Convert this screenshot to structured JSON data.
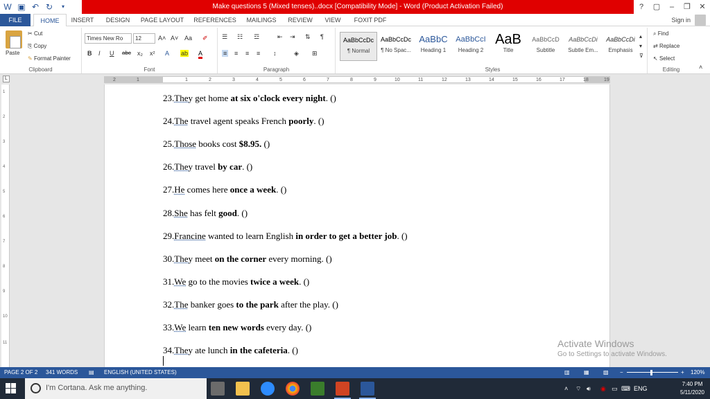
{
  "window": {
    "title": "Make questions 5 (Mixed tenses)..docx [Compatibility Mode] - Word (Product Activation Failed)",
    "controls": [
      "?",
      "▢",
      "–",
      "❐",
      "✕"
    ]
  },
  "tabs": [
    "FILE",
    "HOME",
    "INSERT",
    "DESIGN",
    "PAGE LAYOUT",
    "REFERENCES",
    "MAILINGS",
    "REVIEW",
    "VIEW",
    "FOXIT PDF"
  ],
  "active_tab": "HOME",
  "sign_in": "Sign in",
  "ribbon": {
    "clipboard": {
      "paste": "Paste",
      "cut": "Cut",
      "copy": "Copy",
      "format_painter": "Format Painter",
      "label": "Clipboard"
    },
    "font": {
      "family": "Times New Ro",
      "size": "12",
      "label": "Font"
    },
    "paragraph": {
      "label": "Paragraph"
    },
    "styles": {
      "label": "Styles",
      "items": [
        {
          "preview": "AaBbCcDc",
          "name": "¶ Normal"
        },
        {
          "preview": "AaBbCcDc",
          "name": "¶ No Spac..."
        },
        {
          "preview": "AaBbC",
          "name": "Heading 1"
        },
        {
          "preview": "AaBbCcI",
          "name": "Heading 2"
        },
        {
          "preview": "AaB",
          "name": "Title"
        },
        {
          "preview": "AaBbCcD",
          "name": "Subtitle"
        },
        {
          "preview": "AaBbCcDi",
          "name": "Subtle Em..."
        },
        {
          "preview": "AaBbCcDi",
          "name": "Emphasis"
        }
      ]
    },
    "editing": {
      "find": "Find",
      "replace": "Replace",
      "select": "Select",
      "label": "Editing"
    }
  },
  "ruler_numbers": [
    "2",
    "1",
    "1",
    "2",
    "3",
    "4",
    "5",
    "6",
    "7",
    "8",
    "9",
    "10",
    "11",
    "12",
    "13",
    "14",
    "15",
    "16",
    "17",
    "18",
    "19"
  ],
  "vruler_numbers": [
    "1",
    "2",
    "3",
    "4",
    "5",
    "6",
    "7",
    "8",
    "9",
    "10",
    "11"
  ],
  "document": {
    "lines": [
      {
        "num": "23.",
        "subject": "They",
        "parts": [
          {
            "t": " get home ",
            "b": false
          },
          {
            "t": "at six o'clock every night",
            "b": true
          },
          {
            "t": ". ()",
            "b": false
          }
        ]
      },
      {
        "num": "24.",
        "subject": "The",
        "parts": [
          {
            "t": " travel agent speaks French ",
            "b": false
          },
          {
            "t": "poorly",
            "b": true
          },
          {
            "t": ". ()",
            "b": false
          }
        ]
      },
      {
        "num": "25.",
        "subject": "Those",
        "parts": [
          {
            "t": " books cost ",
            "b": false
          },
          {
            "t": "$8.95.",
            "b": true
          },
          {
            "t": " ()",
            "b": false
          }
        ]
      },
      {
        "num": "26.",
        "subject": "They",
        "parts": [
          {
            "t": " travel ",
            "b": false
          },
          {
            "t": "by car",
            "b": true
          },
          {
            "t": ". ()",
            "b": false
          }
        ]
      },
      {
        "num": "27.",
        "subject": "He",
        "parts": [
          {
            "t": " comes here ",
            "b": false
          },
          {
            "t": "once a week",
            "b": true
          },
          {
            "t": ". ()",
            "b": false
          }
        ]
      },
      {
        "num": "28.",
        "subject": "She",
        "parts": [
          {
            "t": " has felt ",
            "b": false
          },
          {
            "t": "good",
            "b": true
          },
          {
            "t": ". ()",
            "b": false
          }
        ]
      },
      {
        "num": "29.",
        "subject": "Francine",
        "parts": [
          {
            "t": " wanted to learn English ",
            "b": false
          },
          {
            "t": "in order to get a better job",
            "b": true
          },
          {
            "t": ". ()",
            "b": false
          }
        ]
      },
      {
        "num": "30.",
        "subject": "They",
        "parts": [
          {
            "t": " meet ",
            "b": false
          },
          {
            "t": "on the corner",
            "b": true
          },
          {
            "t": " every morning. ()",
            "b": false
          }
        ]
      },
      {
        "num": "31.",
        "subject": "We",
        "parts": [
          {
            "t": " go to the movies ",
            "b": false
          },
          {
            "t": "twice a week",
            "b": true
          },
          {
            "t": ". ()",
            "b": false
          }
        ]
      },
      {
        "num": "32.",
        "subject": "The",
        "parts": [
          {
            "t": " banker goes ",
            "b": false
          },
          {
            "t": "to the park",
            "b": true
          },
          {
            "t": " after the play. ()",
            "b": false
          }
        ]
      },
      {
        "num": "33.",
        "subject": "We",
        "parts": [
          {
            "t": " learn ",
            "b": false
          },
          {
            "t": "ten new words",
            "b": true
          },
          {
            "t": " every day. ()",
            "b": false
          }
        ]
      },
      {
        "num": "34.",
        "subject": "They",
        "parts": [
          {
            "t": " ate lunch ",
            "b": false
          },
          {
            "t": "in the cafeteria",
            "b": true
          },
          {
            "t": ". ()",
            "b": false
          }
        ]
      }
    ]
  },
  "watermark": {
    "line1": "Activate Windows",
    "line2": "Go to Settings to activate Windows."
  },
  "status": {
    "page": "PAGE 2 OF 2",
    "words": "341 WORDS",
    "language": "ENGLISH (UNITED STATES)",
    "zoom": "120%"
  },
  "taskbar": {
    "cortana": "I'm Cortana. Ask me anything.",
    "time": "7:40 PM",
    "date": "5/11/2020",
    "lang": "ENG"
  },
  "colors": {
    "word_blue": "#2b579a",
    "title_red": "#e00000",
    "taskbar": "#202a38"
  }
}
